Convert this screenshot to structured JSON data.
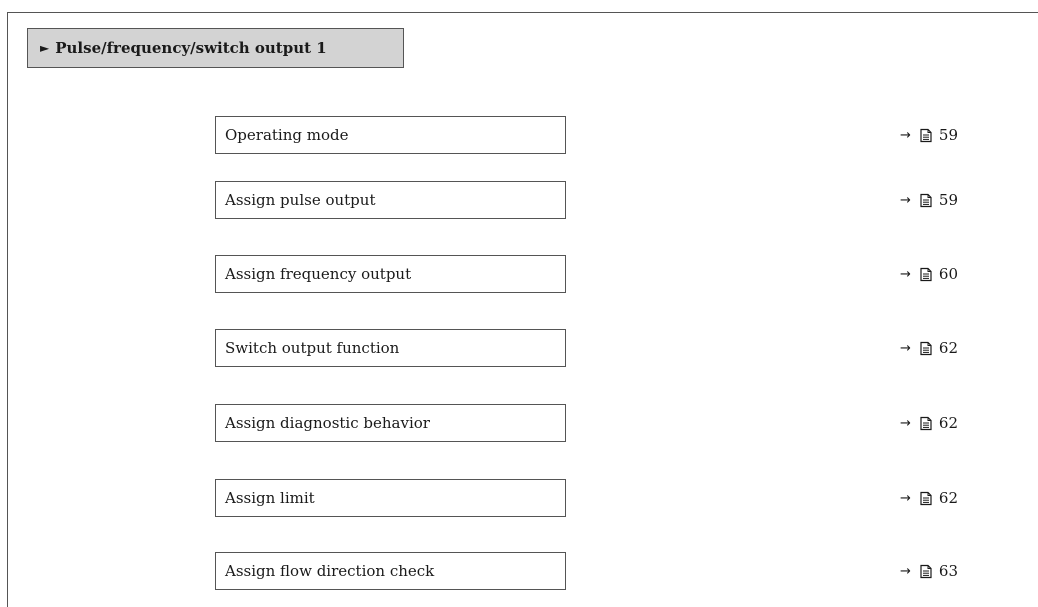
{
  "header": {
    "arrow_glyph": "►",
    "title": "Pulse/frequency/switch output 1"
  },
  "parameters": [
    {
      "label": "Operating mode",
      "page": "59"
    },
    {
      "label": "Assign pulse output",
      "page": "59"
    },
    {
      "label": "Assign frequency output",
      "page": "60"
    },
    {
      "label": "Switch output function",
      "page": "62"
    },
    {
      "label": "Assign diagnostic behavior",
      "page": "62"
    },
    {
      "label": "Assign limit",
      "page": "62"
    },
    {
      "label": "Assign flow direction check",
      "page": "63"
    }
  ],
  "reference": {
    "arrow_glyph": "→",
    "icon": "page-reference-icon"
  },
  "colors": {
    "header_fill": "#d3d3d3",
    "border": "#555555",
    "text": "#1a1a1a"
  }
}
